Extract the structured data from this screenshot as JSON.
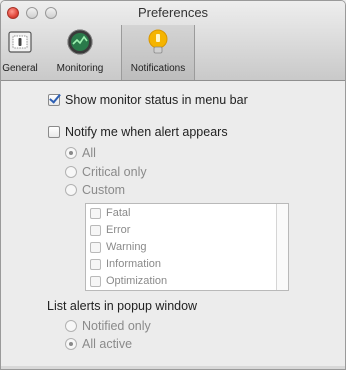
{
  "window": {
    "title": "Preferences"
  },
  "toolbar": {
    "items": [
      {
        "label": "General",
        "icon": "switch-icon",
        "selected": false
      },
      {
        "label": "Monitoring",
        "icon": "gauge-icon",
        "selected": false
      },
      {
        "label": "Notifications",
        "icon": "lightbulb-icon",
        "selected": true
      }
    ]
  },
  "options": {
    "show_status": {
      "label": "Show monitor status in menu bar",
      "checked": true
    },
    "notify_alert": {
      "label": "Notify me when alert appears",
      "checked": false
    },
    "notify_radios": [
      {
        "label": "All",
        "selected": true
      },
      {
        "label": "Critical only",
        "selected": false
      },
      {
        "label": "Custom",
        "selected": false
      }
    ],
    "custom_list": [
      "Fatal",
      "Error",
      "Warning",
      "Information",
      "Optimization"
    ],
    "popup_heading": "List alerts in popup window",
    "popup_radios": [
      {
        "label": "Notified only",
        "selected": false
      },
      {
        "label": "All active",
        "selected": true
      }
    ]
  },
  "colors": {
    "accent_check": "#2d5fb3",
    "close_button": "#e0463a",
    "bulb": "#f5b400"
  }
}
